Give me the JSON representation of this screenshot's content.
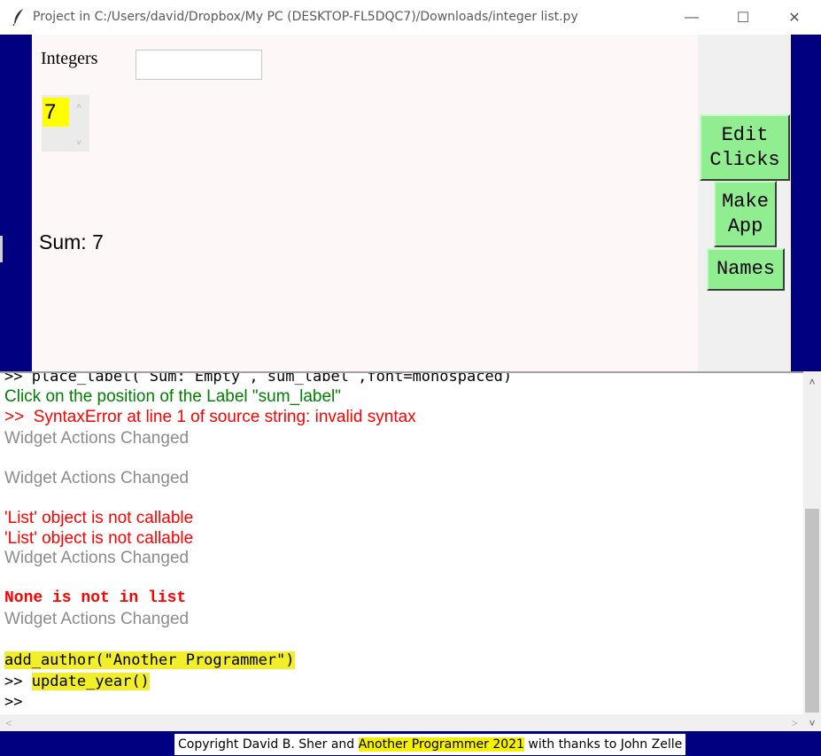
{
  "window": {
    "title": "Project in C:/Users/david/Dropbox/My PC (DESKTOP-FL5DQC7)/Downloads/integer list.py",
    "icon": "feather-icon",
    "min_glyph": "—",
    "max_glyph": "☐",
    "close_glyph": "✕"
  },
  "app": {
    "integers_label": "Integers",
    "integers_input_value": "",
    "spinbox_value": "7",
    "spin_up_glyph": "˄",
    "spin_down_glyph": "˅",
    "sum_label": "Sum: 7",
    "buttons": {
      "edit_clicks": "Edit\nClicks",
      "make_app": "Make\nApp",
      "names": "Names"
    }
  },
  "console": {
    "lines": [
      ">> place_label( Sum: Empty , sum_label ,font=monospaced)",
      "Click on the position of the Label \"sum_label\"",
      ">>  SyntaxError at line 1 of source string: invalid syntax",
      "Widget Actions Changed",
      "Widget Actions Changed",
      "'List' object is not callable",
      "'List' object is not callable",
      "Widget Actions Changed",
      "None is not in list",
      "Widget Actions Changed",
      "add_author(\"Another Programmer\")",
      "update_year()",
      ">>"
    ],
    "prompt": ">>"
  },
  "scrollbars": {
    "up_glyph": "˄",
    "down_glyph": "˅",
    "left_glyph": "<",
    "right_glyph": ">"
  },
  "footer": {
    "prefix": "Copyright David B. Sher and ",
    "highlight": "Another Programmer 2021",
    "suffix": " with thanks to John Zelle"
  },
  "colors": {
    "frame": "#000080",
    "canvas": "#fdf8f7",
    "button_green": "#90ee90",
    "spin_highlight": "#ffff00",
    "error_red": "#ff0000",
    "info_green": "#008000",
    "gray_text": "#8c8c8c",
    "marker_yellow": "#f2ee2a"
  }
}
